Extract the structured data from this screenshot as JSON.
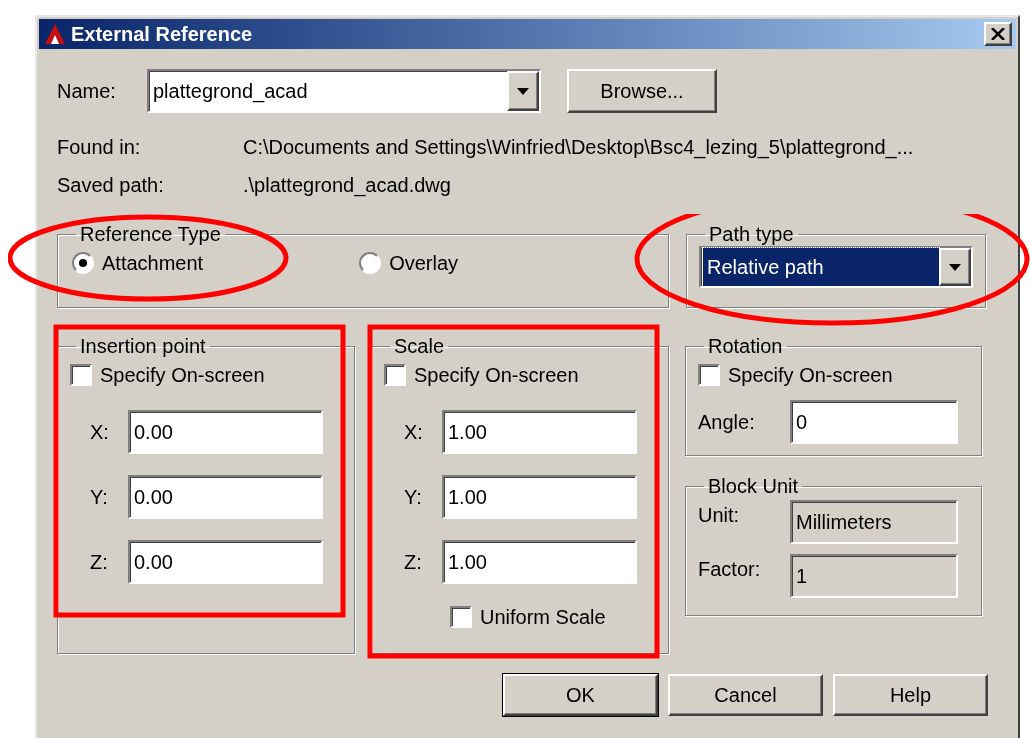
{
  "window": {
    "title": "External Reference"
  },
  "name": {
    "label": "Name:",
    "value": "plattegrond_acad"
  },
  "browse_button": "Browse...",
  "info": [
    {
      "label": "Found in:",
      "value": "C:\\Documents and Settings\\Winfried\\Desktop\\Bsc4_lezing_5\\plattegrond_..."
    },
    {
      "label": "Saved path:",
      "value": ".\\plattegrond_acad.dwg"
    }
  ],
  "reference_type": {
    "title": "Reference Type",
    "options": [
      {
        "label": "Attachment",
        "selected": true
      },
      {
        "label": "Overlay",
        "selected": false
      }
    ]
  },
  "path_type": {
    "title": "Path type",
    "value": "Relative path"
  },
  "insertion_point": {
    "title": "Insertion point",
    "specify_on_screen": {
      "label": "Specify On-screen",
      "checked": false
    },
    "fields": [
      {
        "label": "X:",
        "value": "0.00"
      },
      {
        "label": "Y:",
        "value": "0.00"
      },
      {
        "label": "Z:",
        "value": "0.00"
      }
    ]
  },
  "scale": {
    "title": "Scale",
    "specify_on_screen": {
      "label": "Specify On-screen",
      "checked": false
    },
    "fields": [
      {
        "label": "X:",
        "value": "1.00"
      },
      {
        "label": "Y:",
        "value": "1.00"
      },
      {
        "label": "Z:",
        "value": "1.00"
      }
    ],
    "uniform_scale": {
      "label": "Uniform Scale",
      "checked": false
    }
  },
  "rotation": {
    "title": "Rotation",
    "specify_on_screen": {
      "label": "Specify On-screen",
      "checked": false
    },
    "angle": {
      "label": "Angle:",
      "value": "0"
    }
  },
  "block_unit": {
    "title": "Block Unit",
    "fields": [
      {
        "label": "Unit:",
        "value": "Millimeters",
        "disabled": true
      },
      {
        "label": "Factor:",
        "value": "1",
        "disabled": true
      }
    ]
  },
  "buttons": [
    {
      "label": "OK",
      "default": true
    },
    {
      "label": "Cancel",
      "default": false
    },
    {
      "label": "Help",
      "default": false
    }
  ]
}
